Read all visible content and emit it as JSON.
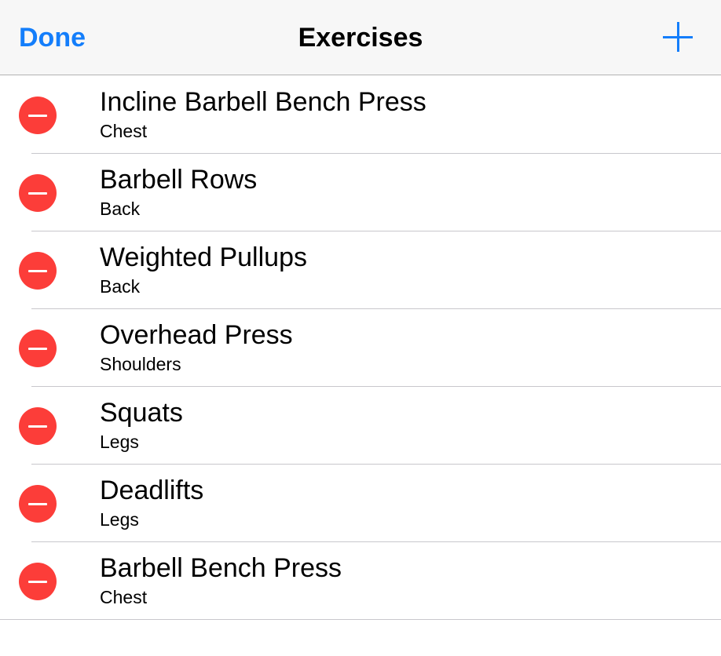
{
  "navbar": {
    "left_label": "Done",
    "title": "Exercises",
    "right_icon": "plus-icon"
  },
  "colors": {
    "accent": "#147efb",
    "delete": "#fc3d39",
    "navbar_bg": "#f7f7f7",
    "separator": "#c8c7cc"
  },
  "exercises": [
    {
      "name": "Incline Barbell Bench Press",
      "category": "Chest"
    },
    {
      "name": "Barbell Rows",
      "category": "Back"
    },
    {
      "name": "Weighted Pullups",
      "category": "Back"
    },
    {
      "name": "Overhead Press",
      "category": "Shoulders"
    },
    {
      "name": "Squats",
      "category": "Legs"
    },
    {
      "name": "Deadlifts",
      "category": "Legs"
    },
    {
      "name": "Barbell Bench Press",
      "category": "Chest"
    }
  ]
}
